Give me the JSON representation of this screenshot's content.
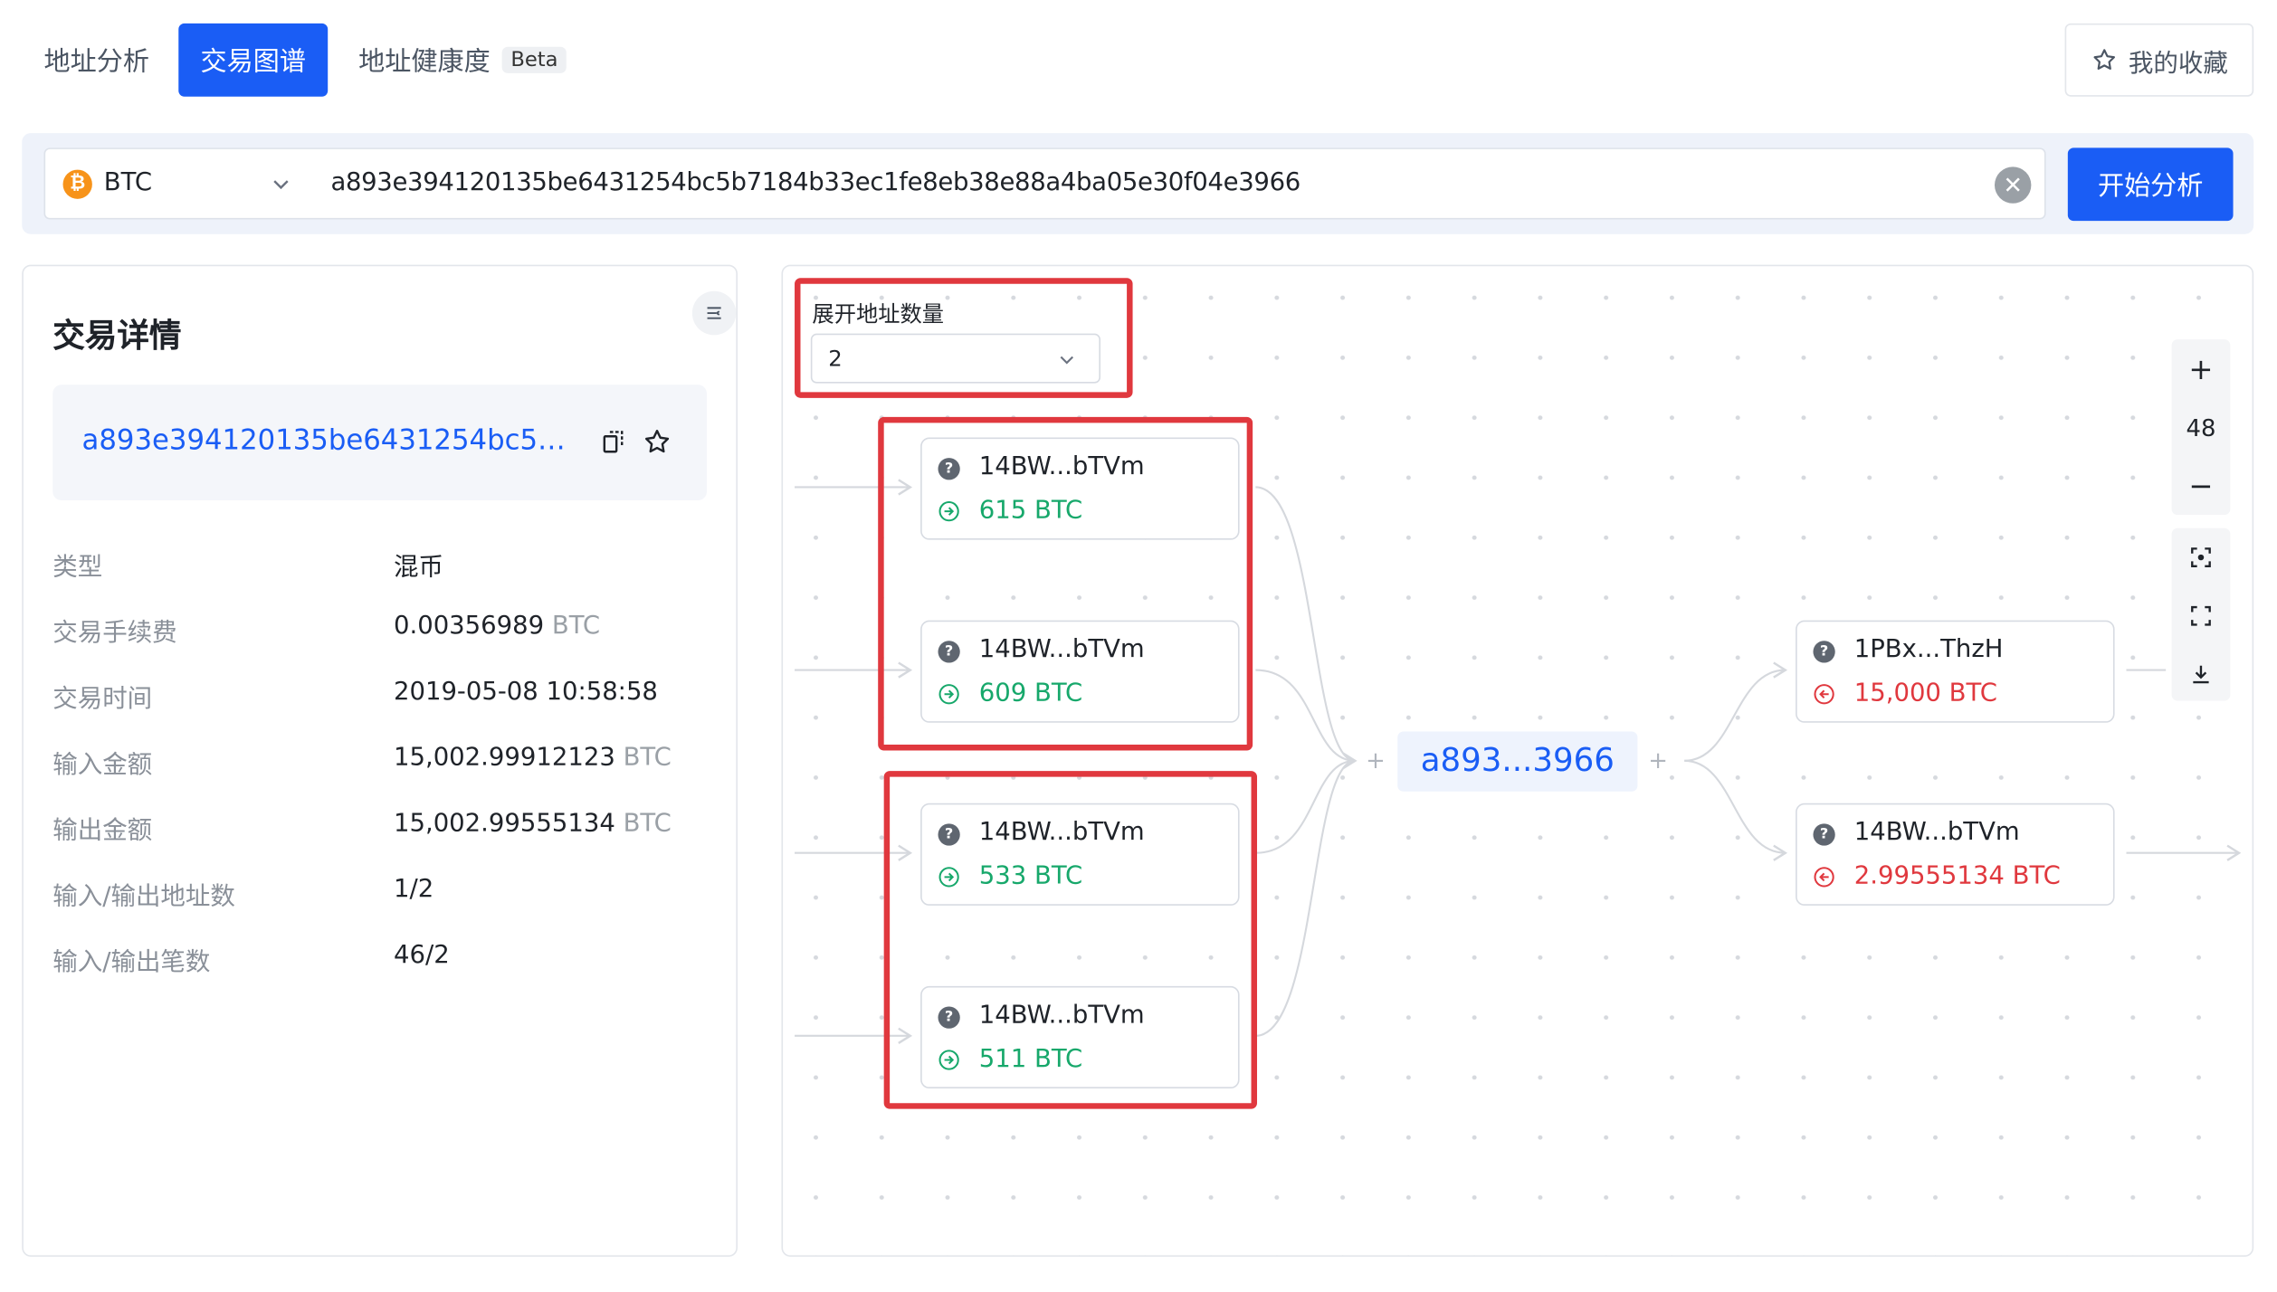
{
  "tabs": [
    {
      "label": "地址分析"
    },
    {
      "label": "交易图谱"
    },
    {
      "label": "地址健康度",
      "badge": "Beta"
    }
  ],
  "favorites_label": "我的收藏",
  "search": {
    "coin": "BTC",
    "value": "a893e394120135be6431254bc5b7184b33ec1fe8eb38e88a4ba05e30f04e3966",
    "button": "开始分析"
  },
  "details": {
    "title": "交易详情",
    "hash": "a893e394120135be6431254bc5b7184b33ec1fe8eb38e88a4ba05e30f04e3966",
    "rows": [
      {
        "label": "类型",
        "value": "混币",
        "unit": ""
      },
      {
        "label": "交易手续费",
        "value": "0.00356989",
        "unit": "BTC"
      },
      {
        "label": "交易时间",
        "value": "2019-05-08 10:58:58",
        "unit": ""
      },
      {
        "label": "输入金额",
        "value": "15,002.99912123",
        "unit": "BTC"
      },
      {
        "label": "输出金额",
        "value": "15,002.99555134",
        "unit": "BTC"
      },
      {
        "label": "输入/输出地址数",
        "value": "1/2",
        "unit": ""
      },
      {
        "label": "输入/输出笔数",
        "value": "46/2",
        "unit": ""
      }
    ]
  },
  "graph": {
    "expand_label": "展开地址数量",
    "expand_value": "2",
    "center": "a893...3966",
    "zoom": "48",
    "inputs": [
      {
        "addr": "14BW...bTVm",
        "amount": "615 BTC"
      },
      {
        "addr": "14BW...bTVm",
        "amount": "609 BTC"
      },
      {
        "addr": "14BW...bTVm",
        "amount": "533 BTC"
      },
      {
        "addr": "14BW...bTVm",
        "amount": "511 BTC"
      }
    ],
    "outputs": [
      {
        "addr": "1PBx...ThzH",
        "amount": "15,000 BTC"
      },
      {
        "addr": "14BW...bTVm",
        "amount": "2.99555134 BTC"
      }
    ]
  },
  "colors": {
    "accent": "#1a5df5",
    "in": "#17a86b",
    "out": "#e0383e",
    "highlight": "#e0383e"
  }
}
